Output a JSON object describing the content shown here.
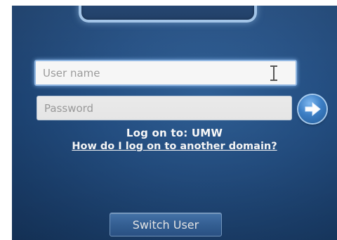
{
  "login": {
    "username_placeholder": "User name",
    "password_placeholder": "Password",
    "logon_to": "Log on to: UMW",
    "other_domain_link": "How do I log on to another domain?",
    "switch_user_label": "Switch User",
    "submit_icon": "arrow-right-icon"
  },
  "colors": {
    "background": "#1b406e",
    "field_glow": "#8fb6e2",
    "text": "#ffffff"
  }
}
